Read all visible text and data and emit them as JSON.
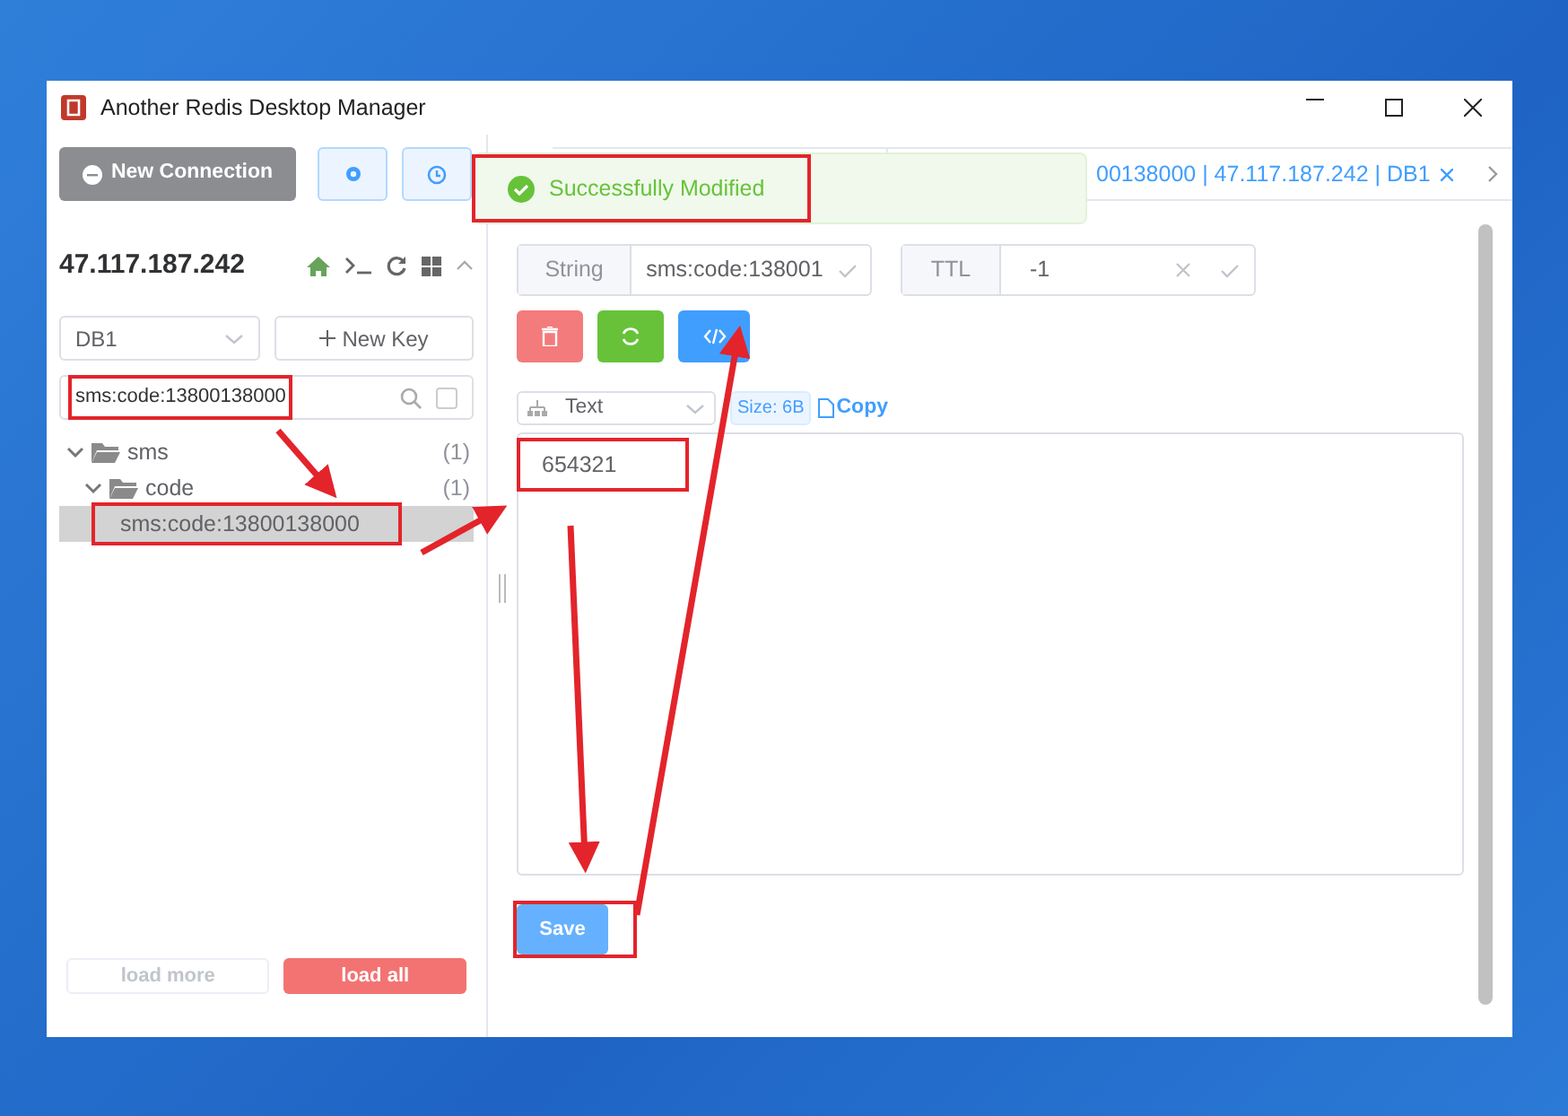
{
  "window": {
    "title": "Another Redis Desktop Manager"
  },
  "new_connection": "New Connection",
  "connection": {
    "host": "47.117.187.242",
    "expanded": true
  },
  "db_select": {
    "value": "DB1"
  },
  "new_key": "New Key",
  "search": {
    "value": "sms:code:13800138000",
    "exact": false
  },
  "tree": [
    {
      "label": "sms",
      "count": "(1)",
      "expanded": true,
      "children": [
        {
          "label": "code",
          "count": "(1)",
          "expanded": true,
          "children": [
            {
              "label": "sms:code:13800138000",
              "selected": true
            }
          ]
        }
      ]
    }
  ],
  "load_more": "load more",
  "load_all": "load all",
  "tabs": [
    {
      "label": "00138000 | 47.117.187.242 | DB1",
      "selected": true
    }
  ],
  "toast": {
    "kind": "success",
    "message": "Successfully Modified"
  },
  "key_header": {
    "type": "String",
    "name": "sms:code:138001",
    "ttl_label": "TTL",
    "ttl": "-1"
  },
  "viewer": {
    "format": "Text",
    "size": "Size: 6B",
    "copy": "Copy"
  },
  "value": "654321",
  "save": "Save"
}
